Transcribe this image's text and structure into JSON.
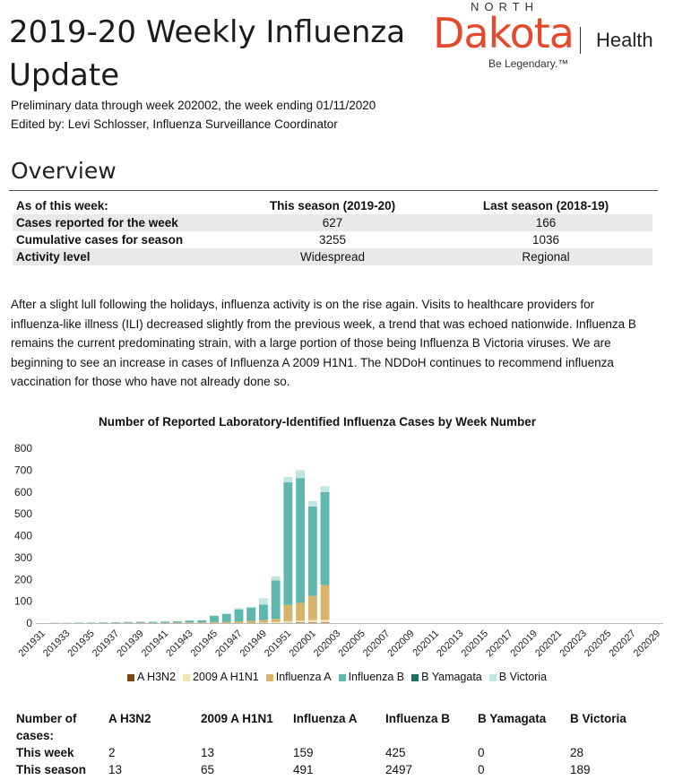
{
  "header": {
    "title": "2019-20 Weekly Influenza Update",
    "subtitle": "Preliminary data through week 202002, the week ending 01/11/2020",
    "editor": "Edited by: Levi Schlosser, Influenza Surveillance Coordinator"
  },
  "logo": {
    "north": "NORTH",
    "dakota": "Dakota",
    "health": "Health",
    "tagline": "Be Legendary.™"
  },
  "overview": {
    "heading": "Overview",
    "columns": [
      "As of this week:",
      "This season (2019-20)",
      "Last season (2018-19)"
    ],
    "rows": [
      [
        "Cases reported for the week",
        "627",
        "166"
      ],
      [
        "Cumulative cases for season",
        "3255",
        "1036"
      ],
      [
        "Activity level",
        "Widespread",
        "Regional"
      ]
    ],
    "paragraph": "After a slight lull following the holidays, influenza activity is on the rise again. Visits to healthcare providers for influenza-like illness (ILI) decreased slightly from the previous week, a trend that was echoed nationwide. Influenza B remains the current predominating strain, with a large portion of those being Influenza B Victoria viruses. We are beginning to see an increase in cases of Influenza A 2009 H1N1. The NDDoH continues to recommend influenza vaccination for those who have not already done so."
  },
  "chart_data": {
    "type": "bar",
    "stacked": true,
    "title": "Number of Reported Laboratory-Identified Influenza Cases by Week Number",
    "xlabel": "",
    "ylabel": "",
    "ylim": [
      0,
      800
    ],
    "yticks": [
      0,
      100,
      200,
      300,
      400,
      500,
      600,
      700,
      800
    ],
    "grid": false,
    "legend_position": "bottom",
    "categories": [
      "201931",
      "201932",
      "201933",
      "201934",
      "201935",
      "201936",
      "201937",
      "201938",
      "201939",
      "201940",
      "201941",
      "201942",
      "201943",
      "201944",
      "201945",
      "201946",
      "201947",
      "201948",
      "201949",
      "201950",
      "201951",
      "201952",
      "202001",
      "202002",
      "202003",
      "202004",
      "202005",
      "202006",
      "202007",
      "202008",
      "202009",
      "202010",
      "202011",
      "202012",
      "202013",
      "202014",
      "202015",
      "202016",
      "202017",
      "202018",
      "202019",
      "202020",
      "202021",
      "202022",
      "202023",
      "202024",
      "202025",
      "202026",
      "202027",
      "202028",
      "202029"
    ],
    "tick_labels": [
      "201931",
      "201933",
      "201935",
      "201937",
      "201939",
      "201941",
      "201943",
      "201945",
      "201947",
      "201949",
      "201951",
      "202001",
      "202003",
      "202005",
      "202007",
      "202009",
      "202011",
      "202013",
      "202015",
      "202017",
      "202019",
      "202021",
      "202023",
      "202025",
      "202027",
      "202029"
    ],
    "series": [
      {
        "name": "A H3N2",
        "color": "#7b4a12",
        "values": [
          0,
          0,
          0,
          0,
          0,
          0,
          0,
          0,
          0,
          0,
          0,
          0,
          0,
          0,
          0,
          0,
          0,
          0,
          0,
          0,
          1,
          2,
          2,
          2,
          0,
          0,
          0,
          0,
          0,
          0,
          0,
          0,
          0,
          0,
          0,
          0,
          0,
          0,
          0,
          0,
          0,
          0,
          0,
          0,
          0,
          0,
          0,
          0,
          0,
          0,
          0
        ]
      },
      {
        "name": "2009 A H1N1",
        "color": "#f4e3b5",
        "values": [
          0,
          0,
          0,
          0,
          0,
          0,
          0,
          0,
          0,
          0,
          0,
          0,
          0,
          0,
          0,
          0,
          0,
          0,
          2,
          5,
          8,
          10,
          12,
          13,
          0,
          0,
          0,
          0,
          0,
          0,
          0,
          0,
          0,
          0,
          0,
          0,
          0,
          0,
          0,
          0,
          0,
          0,
          0,
          0,
          0,
          0,
          0,
          0,
          0,
          0,
          0
        ]
      },
      {
        "name": "Influenza A",
        "color": "#d8b46a",
        "values": [
          0,
          0,
          0,
          0,
          0,
          0,
          1,
          1,
          2,
          1,
          2,
          2,
          3,
          3,
          5,
          6,
          8,
          10,
          12,
          15,
          75,
          80,
          110,
          159,
          0,
          0,
          0,
          0,
          0,
          0,
          0,
          0,
          0,
          0,
          0,
          0,
          0,
          0,
          0,
          0,
          0,
          0,
          0,
          0,
          0,
          0,
          0,
          0,
          0,
          0,
          0
        ]
      },
      {
        "name": "Influenza B",
        "color": "#5fb8ad",
        "values": [
          0,
          1,
          1,
          2,
          2,
          3,
          3,
          4,
          4,
          5,
          5,
          6,
          9,
          10,
          28,
          35,
          55,
          60,
          70,
          175,
          560,
          572,
          410,
          425,
          0,
          0,
          0,
          0,
          0,
          0,
          0,
          0,
          0,
          0,
          0,
          0,
          0,
          0,
          0,
          0,
          0,
          0,
          0,
          0,
          0,
          0,
          0,
          0,
          0,
          0,
          0
        ]
      },
      {
        "name": "B Yamagata",
        "color": "#1f6e5e",
        "values": [
          0,
          0,
          0,
          0,
          0,
          0,
          0,
          0,
          0,
          0,
          0,
          0,
          0,
          0,
          0,
          0,
          0,
          0,
          0,
          0,
          0,
          0,
          0,
          0,
          0,
          0,
          0,
          0,
          0,
          0,
          0,
          0,
          0,
          0,
          0,
          0,
          0,
          0,
          0,
          0,
          0,
          0,
          0,
          0,
          0,
          0,
          0,
          0,
          0,
          0,
          0
        ]
      },
      {
        "name": "B Victoria",
        "color": "#bfe6df",
        "values": [
          0,
          0,
          0,
          0,
          0,
          0,
          0,
          0,
          0,
          0,
          0,
          0,
          1,
          1,
          2,
          4,
          5,
          5,
          30,
          20,
          25,
          36,
          24,
          28,
          0,
          0,
          0,
          0,
          0,
          0,
          0,
          0,
          0,
          0,
          0,
          0,
          0,
          0,
          0,
          0,
          0,
          0,
          0,
          0,
          0,
          0,
          0,
          0,
          0,
          0,
          0
        ]
      }
    ]
  },
  "cases_table": {
    "headers": [
      "Number of cases:",
      "A H3N2",
      "2009 A H1N1",
      "Influenza A",
      "Influenza B",
      "B Yamagata",
      "B Victoria"
    ],
    "rows": [
      [
        "This week",
        "2",
        "13",
        "159",
        "425",
        "0",
        "28"
      ],
      [
        "This season",
        "13",
        "65",
        "491",
        "2497",
        "0",
        "189"
      ]
    ]
  }
}
